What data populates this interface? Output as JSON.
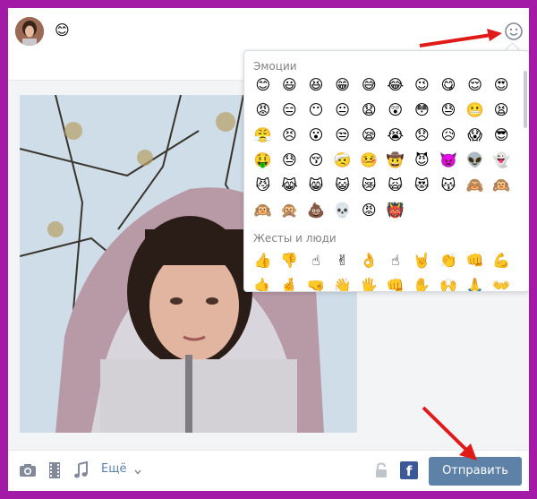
{
  "composer": {
    "inline_emoji": "😊",
    "emoji_toggle_icon": "smile-outline-icon"
  },
  "emoji_panel": {
    "sections": [
      {
        "title": "Эмоции",
        "rows": [
          [
            "😊",
            "😃",
            "😆",
            "😁",
            "😅",
            "😂",
            "😉",
            "😋",
            "😌",
            "😍"
          ],
          [
            "😡",
            "😑",
            "😶",
            "😐",
            "😧",
            "😲",
            "😳",
            "😓",
            "😬",
            "😫"
          ],
          [
            "😤",
            "😣",
            "😮",
            "😒",
            "😪",
            "😭",
            "😞",
            "😥",
            "😱",
            "😎"
          ],
          [
            "🤑",
            "😓",
            "😚",
            "🤕",
            "🤒",
            "🤠",
            "😈",
            "👿",
            "👽",
            "👻"
          ],
          [
            "😼",
            "😹",
            "😸",
            "😺",
            "😿",
            "🙀",
            "😻",
            "😽",
            "🙈",
            "🙉"
          ],
          [
            "🙉",
            "🙊",
            "💩",
            "💀",
            "😡",
            "👹"
          ]
        ]
      },
      {
        "title": "Жесты и люди",
        "rows": [
          [
            "👍",
            "👎",
            "☝",
            "✌",
            "👌",
            "☝",
            "🤘",
            "👏",
            "👊",
            "💪"
          ],
          [
            "🤙",
            "🤞",
            "🤜",
            "👋",
            "🖐",
            "👊",
            "✋",
            "🙌",
            "🙏",
            "👐"
          ]
        ]
      }
    ]
  },
  "toolbar": {
    "more_label": "Ещё",
    "send_label": "Отправить",
    "facebook_label": "f"
  },
  "colors": {
    "frame": "#a21aa6",
    "send_button": "#5e81a8",
    "facebook": "#3b5998",
    "arrow": "#e01919"
  }
}
